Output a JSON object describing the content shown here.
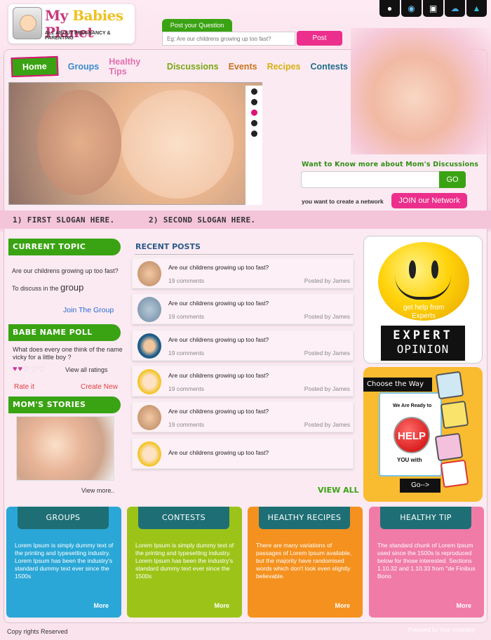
{
  "logo": {
    "title_part1": "My ",
    "title_part2": "Babies",
    "title_part3": " Planet",
    "subtitle": "ALL ABOUT PREGNANCY & PARENTING"
  },
  "question": {
    "tab_label": "Post your Question",
    "placeholder": "Eg: Are our childrens growing up too fast?",
    "post_label": "Post"
  },
  "top_icons": [
    "bulb-icon",
    "dashboard-icon",
    "lock-icon",
    "cloud-icon",
    "twitter-icon"
  ],
  "nav": {
    "home": "Home",
    "items": [
      {
        "label": "Groups",
        "color": "#3a8bd0"
      },
      {
        "label": "Healthy Tips",
        "color": "#e46fb0"
      },
      {
        "label": "Discussions",
        "color": "#7aa612"
      },
      {
        "label": "Events",
        "color": "#c9731d"
      },
      {
        "label": "Recipes",
        "color": "#d6b111"
      },
      {
        "label": "Contests",
        "color": "#1f6c8a"
      }
    ]
  },
  "network": {
    "want_text": "Want to Know more about Mom's Discussions",
    "go_label": "GO",
    "create_text": "you want to create a network",
    "join_label": "JOIN our Network"
  },
  "slogans": [
    "1)  FIRST SLOGAN HERE.",
    "2)  SECOND SLOGAN HERE."
  ],
  "current_topic": {
    "title": "CURRENT TOPIC",
    "question": "Are our childrens growing up too fast?",
    "discuss_prefix": "To discuss in the ",
    "discuss_word": "group",
    "join_label": "Join The Group"
  },
  "poll": {
    "title": "BABE NAME POLL",
    "question": "What does every one think of the name vicky for a little boy ?",
    "rating": 2,
    "max_rating": 5,
    "view_all_ratings": "View all ratings",
    "rate_it": "Rate it",
    "create_new": "Create New"
  },
  "stories": {
    "title": "MOM'S STORIES",
    "view_more": "View more.."
  },
  "recent_posts": {
    "title": "RECENT POSTS",
    "view_all": "VIEW ALL",
    "posts": [
      {
        "question": "Are our childrens growing up too fast?",
        "comments": "19 comments",
        "by": "Posted by James",
        "avatar": "man-face-icon"
      },
      {
        "question": "Are our childrens growing up too fast?",
        "comments": "19 comments",
        "by": "Posted by James",
        "avatar": "user-silhouette-icon"
      },
      {
        "question": "Are our childrens growing up too fast?",
        "comments": "19 comments",
        "by": "Posted by James",
        "avatar": "businessman-icon"
      },
      {
        "question": "Are our childrens growing up too fast?",
        "comments": "19 comments",
        "by": "Posted by James",
        "avatar": "blonde-woman-icon"
      },
      {
        "question": "Are our childrens growing up too fast?",
        "comments": "19 comments",
        "by": "Posted by James",
        "avatar": "man-face-icon"
      },
      {
        "question": "Are our childrens growing up too fast?",
        "comments": "",
        "by": "",
        "avatar": "blonde-woman-icon"
      }
    ]
  },
  "expert": {
    "help_text": "get help from Experts",
    "line1": "EXPERT",
    "line2": "OPINION"
  },
  "choose": {
    "title": "Choose the Way",
    "ready": "We Are Ready to",
    "help": "HELP",
    "you_with": "YOU with",
    "go": "Go-->"
  },
  "bottom_boxes": [
    {
      "title": "GROUPS",
      "text": "Lorem Ipsum is simply dummy text of the printing and typesetting industry. Lorem Ipsum has been the industry's standard dummy text ever since the 1500s",
      "more": "More",
      "bg": "#2aa7d7"
    },
    {
      "title": "CONTESTS",
      "text": "Lorem Ipsum is simply dummy text of the printing and typesetting industry. Lorem Ipsum has been the industry's standard dummy text ever since the 1500s",
      "more": "More",
      "bg": "#9cc418"
    },
    {
      "title": "HEALTHY RECIPES",
      "text": "There are many variations of passages of Lorem Ipsum available, but the majority have randomised words which don't look even slightly believable.",
      "more": "More",
      "bg": "#f5911e"
    },
    {
      "title": "HEALTHY TIP",
      "text": "The standard chunk of Lorem Ipsum used since the 1500s is reproduced below for those interested. Sections 1.10.32 and 1.10.33 from \"de Finibus Bono",
      "more": "More",
      "bg": "#f07ba6"
    }
  ],
  "footer": {
    "copyright": "Copy rights Reserved",
    "powered": "Powered by Your company"
  }
}
